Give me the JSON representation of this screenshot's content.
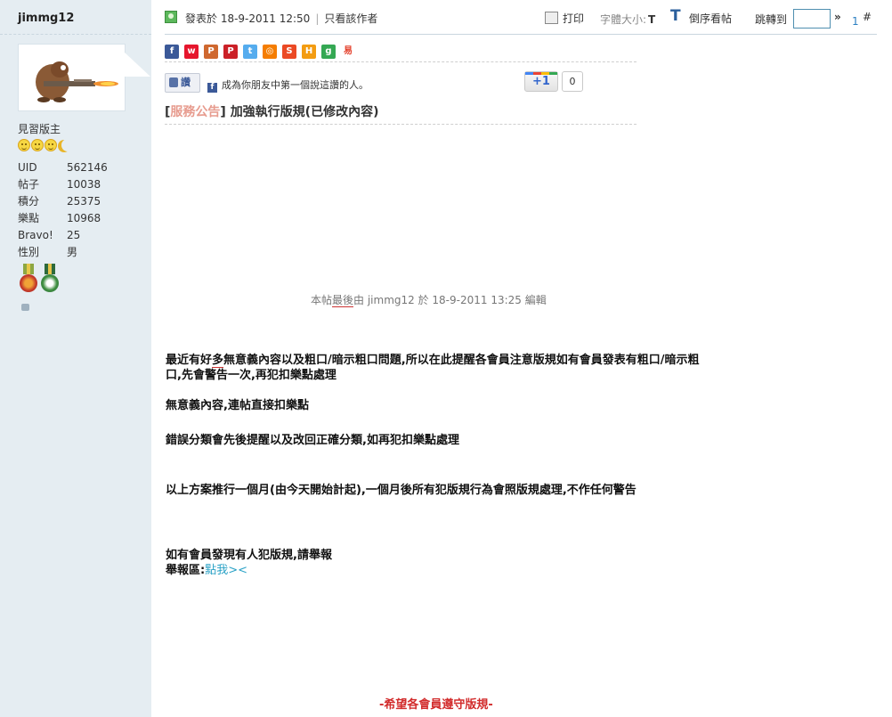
{
  "author": {
    "username": "jimmg12",
    "rank": "見習版主",
    "stats": [
      {
        "key": "UID",
        "value": "562146"
      },
      {
        "key": "帖子",
        "value": "10038"
      },
      {
        "key": "積分",
        "value": "25375"
      },
      {
        "key": "樂點",
        "value": "10968"
      },
      {
        "key": "Bravo!",
        "value": "25"
      },
      {
        "key": "性別",
        "value": "男"
      }
    ]
  },
  "post_header": {
    "posted_at": "發表於 18-9-2011 12:50",
    "only_author": "只看該作者",
    "print": "打印",
    "font_size_label": "字體大小:",
    "font_small": "T",
    "font_large": "T",
    "reverse": "倒序看帖",
    "jump_to": "跳轉到",
    "jump_go": "»",
    "floor_number": "1",
    "floor_hash": "#"
  },
  "social": {
    "share_icons": [
      "facebook-icon",
      "weibo-icon",
      "plurk-icon",
      "pinterest-icon",
      "twitter-icon",
      "mixi-icon",
      "stumble-icon",
      "hd-icon",
      "google-icon",
      "yi-icon"
    ],
    "like_label": "讚",
    "fb_text": "成為你朋友中第一個說這讚的人。",
    "gplus_label": "+1",
    "gplus_count": "0"
  },
  "post": {
    "category": "服務公告",
    "title": "加強執行版規(已修改內容)",
    "edit_note": {
      "pre": "本帖",
      "underlined": "最後",
      "post": "由 jimmg12 於 18-9-2011 13:25 編輯"
    },
    "p1_a": "最近有好",
    "p1_u": "多",
    "p1_b": "無意義內容以及粗口/暗示粗口問題,所以在此提醒各會員注意版規如有會員發表有粗口/暗示粗口,先會警告一次,再犯扣樂點處理",
    "p2": "無意義內容,連帖直接扣樂點",
    "p3": "錯誤分類會先後提醒以及改回正確分類,如再犯扣樂點處理",
    "p4": "以上方案推行一個月(由今天開始計起),一個月後所有犯版規行為會照版規處理,不作任何警告",
    "p5_line1": "如有會員發現有人犯版規,請舉報",
    "p5_label": "舉報區:",
    "p5_link": "點我><",
    "closing": "-希望各會員遵守版規-"
  },
  "colors": {
    "sidebar_bg": "#e5edf2",
    "category": "#e79b8e",
    "link": "#2ba2c6",
    "closing": "#d22c2c"
  }
}
